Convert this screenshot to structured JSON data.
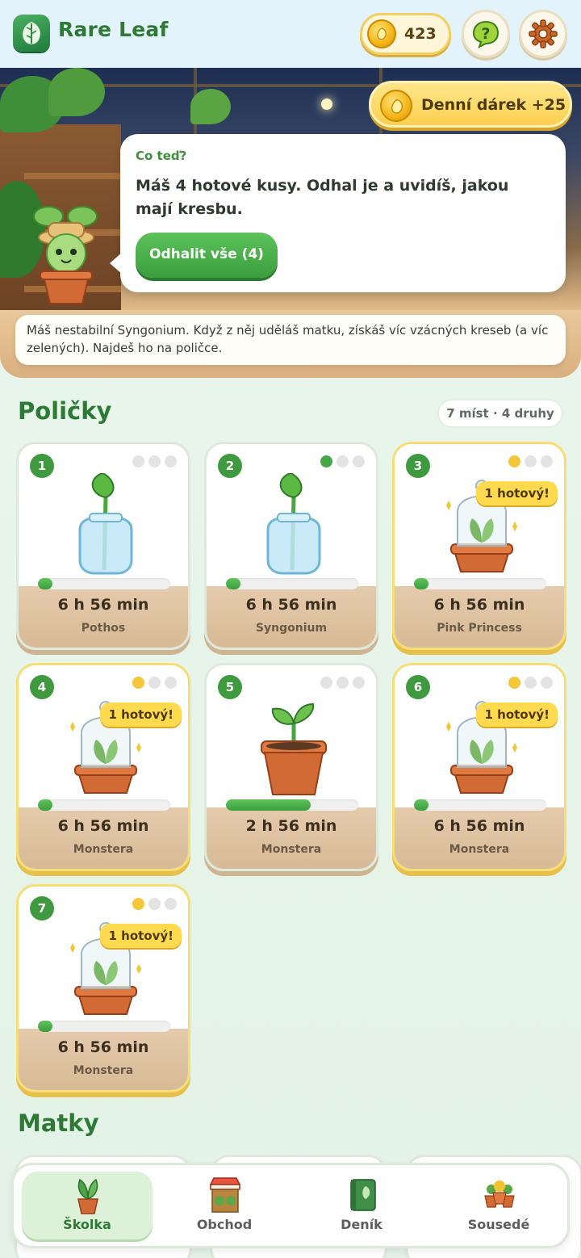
{
  "app": {
    "title": "Rare Leaf",
    "coins": "423"
  },
  "colors": {
    "brand_green": "#2e7a35",
    "accent_gold": "#f5c53a",
    "progress_green": "#3b9e3d"
  },
  "icons": {
    "logo": "leaf-icon",
    "coin": "coin-icon",
    "help": "question-bubble-icon",
    "settings": "gear-icon"
  },
  "hero": {
    "daily_gift_label": "Denní dárek +25",
    "bubble_kicker": "Co teď?",
    "bubble_text": "Máš 4 hotové kusy. Odhal je a uvidíš, jakou mají kresbu.",
    "reveal_button": "Odhalit vše (4)",
    "hint": "Máš nestabilní Syngonium. Když z něj uděláš matku, získáš víc vzácných kreseb (a víc zelených). Najdeš ho na poličce."
  },
  "shelves": {
    "title": "Poličky",
    "stat": "7 míst · 4 druhy",
    "slots": [
      {
        "num": "1",
        "time": "6 h 56 min",
        "name": "Pothos",
        "kind": "cutting-jar",
        "progress": 0.11,
        "dots": [
          "empty",
          "empty",
          "empty"
        ],
        "badge": ""
      },
      {
        "num": "2",
        "time": "6 h 56 min",
        "name": "Syngonium",
        "kind": "cutting-jar",
        "progress": 0.11,
        "dots": [
          "green",
          "empty",
          "empty"
        ],
        "badge": ""
      },
      {
        "num": "3",
        "time": "6 h 56 min",
        "name": "Pink Princess",
        "kind": "dome",
        "progress": 0.11,
        "dots": [
          "gold",
          "empty",
          "empty"
        ],
        "badge": "1 hotový!"
      },
      {
        "num": "4",
        "time": "6 h 56 min",
        "name": "Monstera",
        "kind": "dome",
        "progress": 0.11,
        "dots": [
          "gold",
          "empty",
          "empty"
        ],
        "badge": "1 hotový!"
      },
      {
        "num": "5",
        "time": "2 h 56 min",
        "name": "Monstera",
        "kind": "sprout-pot",
        "progress": 0.64,
        "dots": [
          "empty",
          "empty",
          "empty"
        ],
        "badge": ""
      },
      {
        "num": "6",
        "time": "6 h 56 min",
        "name": "Monstera",
        "kind": "dome",
        "progress": 0.11,
        "dots": [
          "gold",
          "empty",
          "empty"
        ],
        "badge": "1 hotový!"
      },
      {
        "num": "7",
        "time": "6 h 56 min",
        "name": "Monstera",
        "kind": "dome",
        "progress": 0.11,
        "dots": [
          "gold",
          "empty",
          "empty"
        ],
        "badge": "1 hotový!"
      }
    ]
  },
  "matky": {
    "title": "Matky"
  },
  "nav": {
    "items": [
      {
        "label": "Školka",
        "icon": "potted-plant-icon",
        "active": true
      },
      {
        "label": "Obchod",
        "icon": "market-stall-icon",
        "active": false
      },
      {
        "label": "Deník",
        "icon": "book-icon",
        "active": false
      },
      {
        "label": "Sousedé",
        "icon": "plant-group-icon",
        "active": false
      }
    ]
  }
}
